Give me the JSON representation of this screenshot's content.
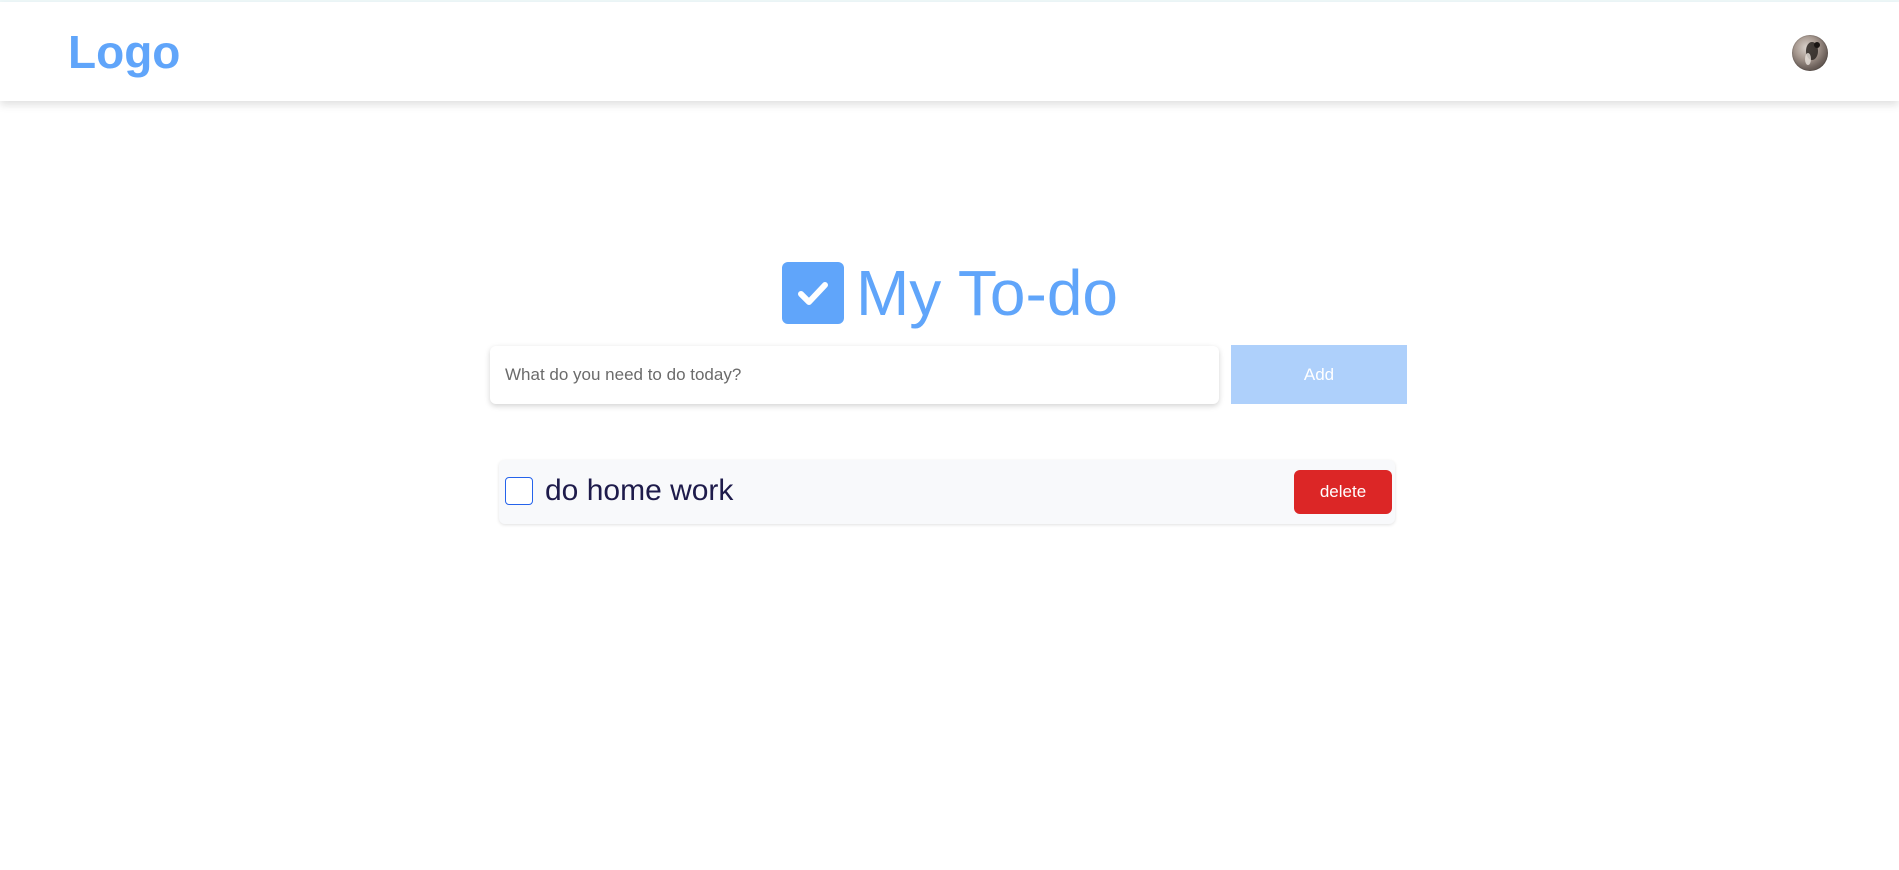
{
  "header": {
    "logo_text": "Logo"
  },
  "main": {
    "title": "My To-do",
    "title_icon": "checkbox-checked-icon",
    "input": {
      "placeholder": "What do you need to do today?",
      "value": ""
    },
    "add_label": "Add",
    "todos": [
      {
        "text": "do home work",
        "checked": false,
        "delete_label": "delete"
      }
    ]
  },
  "colors": {
    "accent": "#60a5fa",
    "add_button_bg": "#aed0fb",
    "delete_button_bg": "#dc2626",
    "todo_text": "#1e1b4b",
    "checkbox_border": "#2563eb"
  }
}
